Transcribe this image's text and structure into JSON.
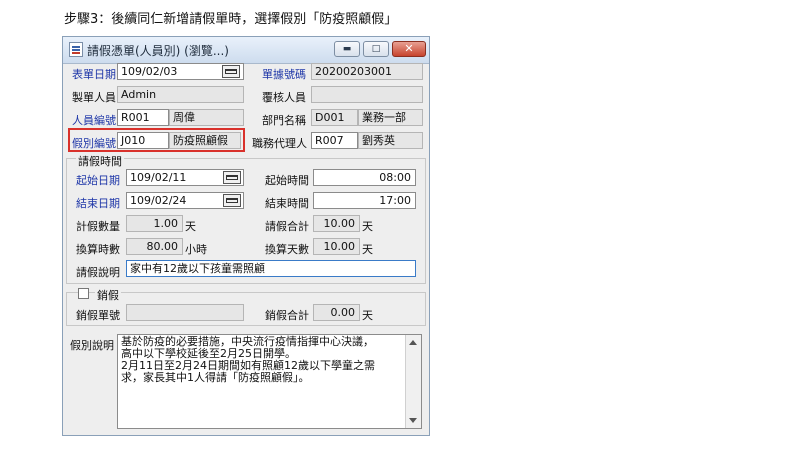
{
  "caption": "步驟3：後續同仁新增請假單時，選擇假別「防疫照顧假」",
  "window": {
    "title": "請假憑單(人員別) (瀏覽...)",
    "buttons": {
      "minimize": "▬",
      "maximize": "□",
      "close": "✕"
    }
  },
  "form": {
    "bill_date_label": "表單日期",
    "bill_date": "109/02/03",
    "bill_no_label": "單據號碼",
    "bill_no": "20200203001",
    "maker_label": "製單人員",
    "maker": "Admin",
    "reviewer_label": "覆核人員",
    "reviewer": "",
    "emp_no_label": "人員編號",
    "emp_no": "R001",
    "emp_name": "周偉",
    "dept_label": "部門名稱",
    "dept_no": "D001",
    "dept_name": "業務一部",
    "leave_type_label": "假別編號",
    "leave_type_no": "J010",
    "leave_type_name": "防疫照顧假",
    "agent_label": "職務代理人",
    "agent_no": "R007",
    "agent_name": "劉秀英"
  },
  "leave_time": {
    "group_label": "請假時間",
    "start_date_label": "起始日期",
    "start_date": "109/02/11",
    "start_time_label": "起始時間",
    "start_time": "08:00",
    "end_date_label": "結束日期",
    "end_date": "109/02/24",
    "end_time_label": "結束時間",
    "end_time": "17:00",
    "calc_qty_label": "計假數量",
    "calc_qty": "1.00",
    "calc_qty_unit": "天",
    "total_label": "請假合計",
    "total": "10.00",
    "total_unit": "天",
    "conv_hours_label": "換算時數",
    "conv_hours": "80.00",
    "conv_hours_unit": "小時",
    "conv_days_label": "換算天數",
    "conv_days": "10.00",
    "conv_days_unit": "天",
    "desc_label": "請假說明",
    "desc": "家中有12歲以下孩童需照顧"
  },
  "cancel": {
    "checkbox_label": "銷假",
    "cancel_no_label": "銷假單號",
    "cancel_no": "",
    "cancel_total_label": "銷假合計",
    "cancel_total": "0.00",
    "cancel_total_unit": "天"
  },
  "leave_note": {
    "label": "假別說明",
    "text": "基於防疫的必要措施，中央流行疫情指揮中心決議，\n高中以下學校延後至2月25日開學。\n2月11日至2月24日期間如有照顧12歲以下學童之需\n求，家長其中1人得請「防疫照顧假」。"
  }
}
